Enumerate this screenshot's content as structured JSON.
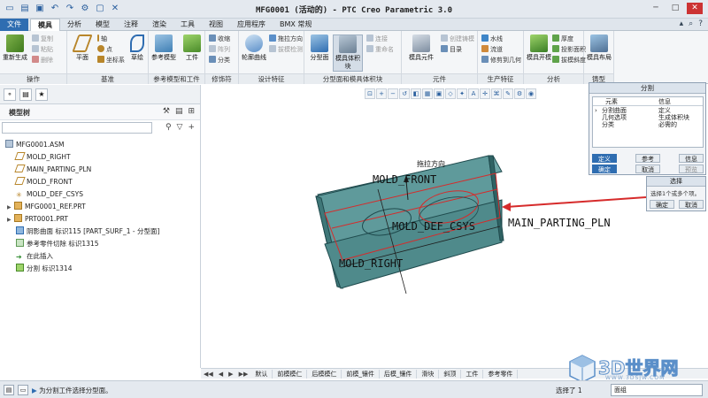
{
  "window": {
    "title": "MFG0001 (活动的) - PTC Creo Parametric 3.0"
  },
  "menu_tabs": [
    "文件",
    "模具",
    "分析",
    "模型",
    "注释",
    "渲染",
    "工具",
    "视图",
    "应用程序",
    "BMX 常规"
  ],
  "ribbon": {
    "groups": [
      {
        "label": "操作",
        "items": [
          "重新生成",
          "复制",
          "粘贴",
          "删除"
        ]
      },
      {
        "label": "基准",
        "items": [
          "平面",
          "轴",
          "点",
          "坐标系",
          "草绘"
        ]
      },
      {
        "label": "参考模型和工件",
        "items": [
          "参考模型",
          "工件"
        ]
      },
      {
        "label": "修饰符",
        "items": [
          "收缩",
          "阵列",
          "分类"
        ]
      },
      {
        "label": "设计特征",
        "items": [
          "轮廓曲线",
          "拖拉方向",
          "拔模检测"
        ]
      },
      {
        "label": "分型面和模具体积块",
        "items": [
          "分型面",
          "模具体积块",
          "连接",
          "重命名"
        ]
      },
      {
        "label": "元件",
        "items": [
          "模具元件",
          "创建铸模",
          "目录"
        ]
      },
      {
        "label": "生产特征",
        "items": [
          "水线",
          "流道",
          "修剪到几何"
        ]
      },
      {
        "label": "分析",
        "items": [
          "模具开模",
          "厚度",
          "投影面积",
          "拔模斜度"
        ]
      },
      {
        "label": "铸型",
        "items": [
          "模具布局"
        ]
      }
    ]
  },
  "model_tree": {
    "title": "模型树",
    "items": [
      "MFG0001.ASM",
      "MOLD_RIGHT",
      "MAIN_PARTING_PLN",
      "MOLD_FRONT",
      "MOLD_DEF_CSYS",
      "MFG0001_REF.PRT",
      "PRT0001.PRT",
      "阴影曲面 标识115 [PART_SURF_1 - 分型面]",
      "参考零件切除 标识1315",
      "在此插入",
      "分割 标识1314"
    ]
  },
  "canvas": {
    "labels": {
      "pull_direction": "拖拉方向",
      "mold_front": "MOLD_FRONT",
      "mold_def_csys": "MOLD_DEF_CSYS",
      "main_parting": "MAIN_PARTING_PLN",
      "mold_right": "MOLD_RIGHT"
    }
  },
  "split_dialog": {
    "title": "分割",
    "col_element": "元素",
    "col_info": "信息",
    "rows": [
      {
        "element": "分割曲面",
        "info": "定义"
      },
      {
        "element": "几何选项",
        "info": "生成体积块"
      },
      {
        "element": "分类",
        "info": "必需的"
      }
    ],
    "btn_define": "定义",
    "btn_reference": "参考",
    "btn_info": "信息",
    "btn_ok": "确定",
    "btn_cancel": "取消",
    "btn_preview": "预览"
  },
  "select_box": {
    "title": "选择",
    "text": "选择1个或多个项。",
    "btn_ok": "确定",
    "btn_cancel": "取消"
  },
  "bottom_tabs": [
    "默认",
    "前模模仁",
    "后模模仁",
    "前模_镶件",
    "后模_镶件",
    "滑块",
    "斜顶",
    "工件",
    "参考零件"
  ],
  "status": {
    "message": "为分割工件选择分型面。",
    "selected": "选择了 1",
    "filter": "面组"
  },
  "watermark": {
    "text": "3D世界网",
    "url": "WWW.3DSJW.COM"
  },
  "colors": {
    "model_fill": "#5f9a9b",
    "model_edge": "#1f4a4d",
    "highlight": "#d62b2b",
    "accent": "#2f6db1"
  }
}
